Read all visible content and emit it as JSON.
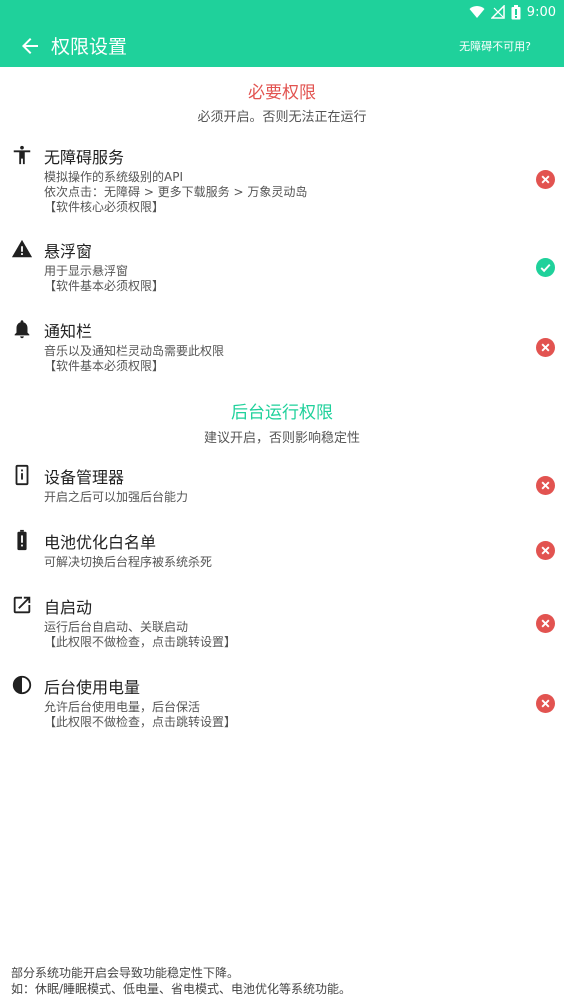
{
  "status_bar": {
    "time": "9:00"
  },
  "app_bar": {
    "title": "权限设置",
    "help_link": "无障碍不可用?"
  },
  "sections": [
    {
      "title": "必要权限",
      "subtitle": "必须开启。否则无法正在运行"
    },
    {
      "title": "后台运行权限",
      "subtitle": "建议开启，否则影响稳定性"
    }
  ],
  "permissions": [
    {
      "title": "无障碍服务",
      "desc": "模拟操作的系统级别的API\n依次点击：无障碍 > 更多下载服务 > 万象灵动岛\n【软件核心必须权限】",
      "icon": "accessibility-icon",
      "granted": false
    },
    {
      "title": "悬浮窗",
      "desc": "用于显示悬浮窗\n【软件基本必须权限】",
      "icon": "warning-icon",
      "granted": true
    },
    {
      "title": "通知栏",
      "desc": "音乐以及通知栏灵动岛需要此权限\n【软件基本必须权限】",
      "icon": "bell-icon",
      "granted": false
    },
    {
      "title": "设备管理器",
      "desc": "开启之后可以加强后台能力",
      "icon": "device-info-icon",
      "granted": false
    },
    {
      "title": "电池优化白名单",
      "desc": "可解决切换后台程序被系统杀死",
      "icon": "battery-alert-icon",
      "granted": false
    },
    {
      "title": "自启动",
      "desc": "运行后台自启动、关联启动\n【此权限不做检查，点击跳转设置】",
      "icon": "open-external-icon",
      "granted": false
    },
    {
      "title": "后台使用电量",
      "desc": "允许后台使用电量，后台保活\n【此权限不做检查，点击跳转设置】",
      "icon": "contrast-icon",
      "granted": false
    }
  ],
  "footer": "部分系统功能开启会导致功能稳定性下降。\n如：休眠/睡眠模式、低电量、省电模式、电池优化等系统功能。",
  "colors": {
    "accent": "#1fd19b",
    "error": "#e25350"
  }
}
